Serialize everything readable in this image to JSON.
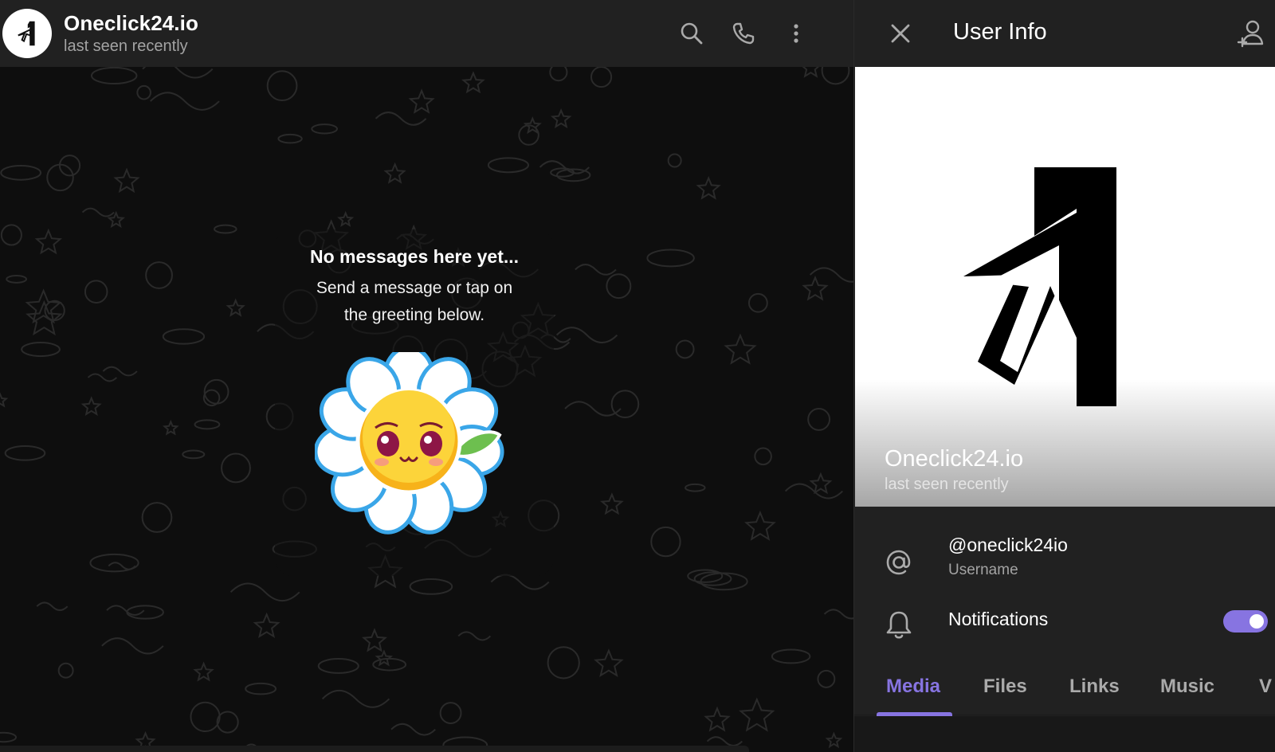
{
  "chat": {
    "title": "Oneclick24.io",
    "status": "last seen recently",
    "empty_title": "No messages here yet...",
    "empty_line1": "Send a message or tap on",
    "empty_line2": "the greeting below.",
    "icons": [
      "search-icon",
      "phone-icon",
      "more-vertical-icon"
    ]
  },
  "info": {
    "title": "User Info",
    "profile_name": "Oneclick24.io",
    "profile_status": "last seen recently",
    "username": "@oneclick24io",
    "username_label": "Username",
    "notifications_label": "Notifications",
    "notifications_on": true,
    "tabs": [
      "Media",
      "Files",
      "Links",
      "Music",
      "V"
    ],
    "active_tab": "Media",
    "icons": [
      "close-icon",
      "add-contact-icon",
      "at-sign-icon",
      "bell-icon"
    ]
  },
  "colors": {
    "accent": "#8774e1",
    "header_bg": "#212121",
    "chat_bg": "#0e0e0e"
  }
}
